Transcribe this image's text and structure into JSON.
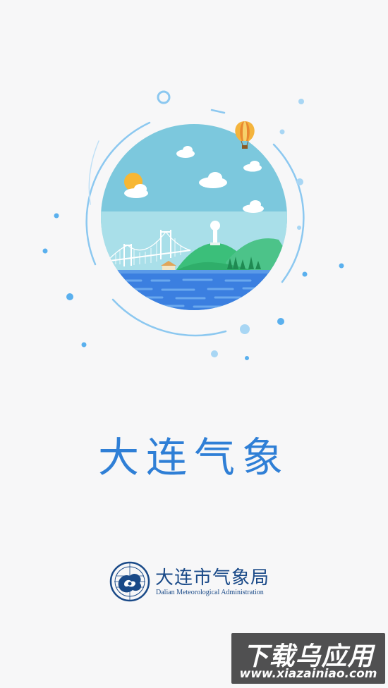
{
  "app": {
    "title": "大连气象"
  },
  "organization": {
    "name_cn": "大连市气象局",
    "name_en": "Dalian Meteorological Administration"
  },
  "watermark": {
    "text_cn": "下载乌应用",
    "url": "www.xiazainiao.com"
  },
  "colors": {
    "background": "#f7f7f8",
    "title_blue": "#2f7fd6",
    "org_blue": "#1a4a88",
    "sky": "#7cc8dd",
    "sea": "#3b7fe0",
    "hill_green": "#4cc389",
    "accent_dot": "#5ab0ee"
  }
}
